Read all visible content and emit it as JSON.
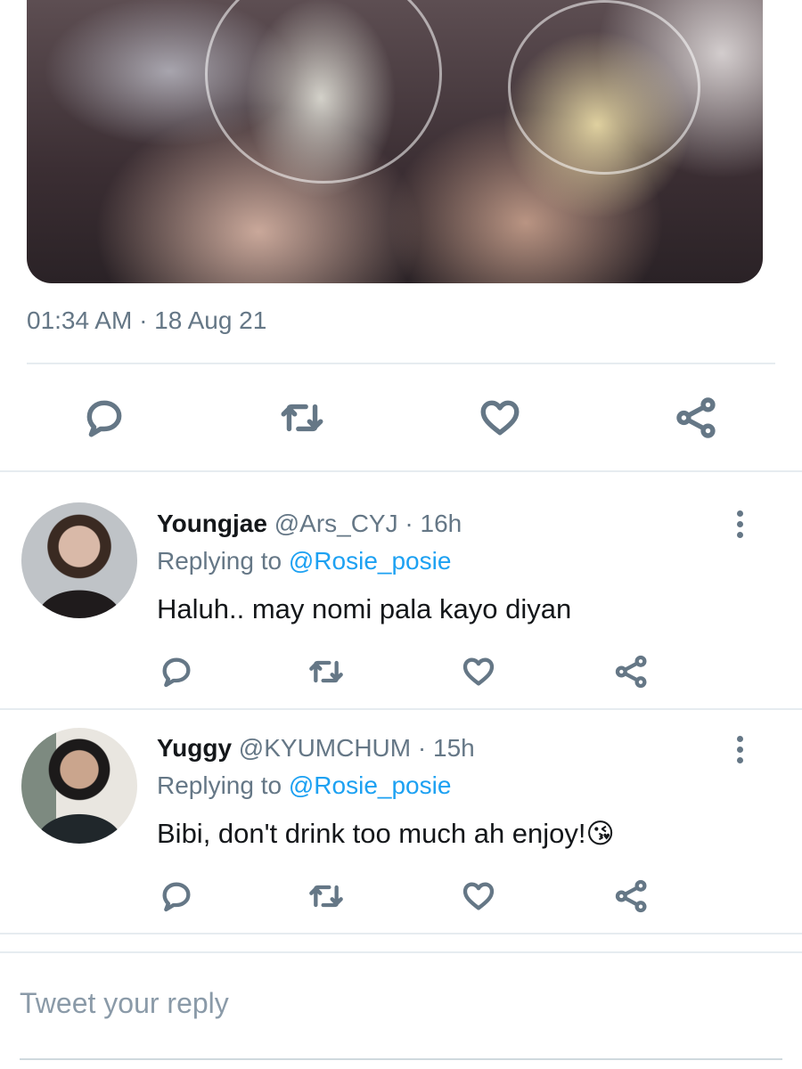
{
  "tweet": {
    "timestamp": "01:34 AM · 18 Aug 21",
    "actions": [
      "reply-icon",
      "retweet-icon",
      "like-icon",
      "share-icon"
    ]
  },
  "replies": [
    {
      "name": "Youngjae",
      "handle": "@Ars_CYJ",
      "time": "· 16h",
      "replying_label": "Replying to",
      "replying_handle": "@Rosie_posie",
      "text": "Haluh.. may nomi pala kayo diyan",
      "emoji": ""
    },
    {
      "name": "Yuggy",
      "handle": "@KYUMCHUM",
      "time": "· 15h",
      "replying_label": "Replying to",
      "replying_handle": "@Rosie_posie",
      "text": "Bibi, don't drink too much ah enjoy!",
      "emoji": "😘"
    }
  ],
  "composer": {
    "placeholder": "Tweet your reply"
  },
  "colors": {
    "muted": "#657786",
    "link": "#1da1f2",
    "divider": "#e6ecf0"
  }
}
